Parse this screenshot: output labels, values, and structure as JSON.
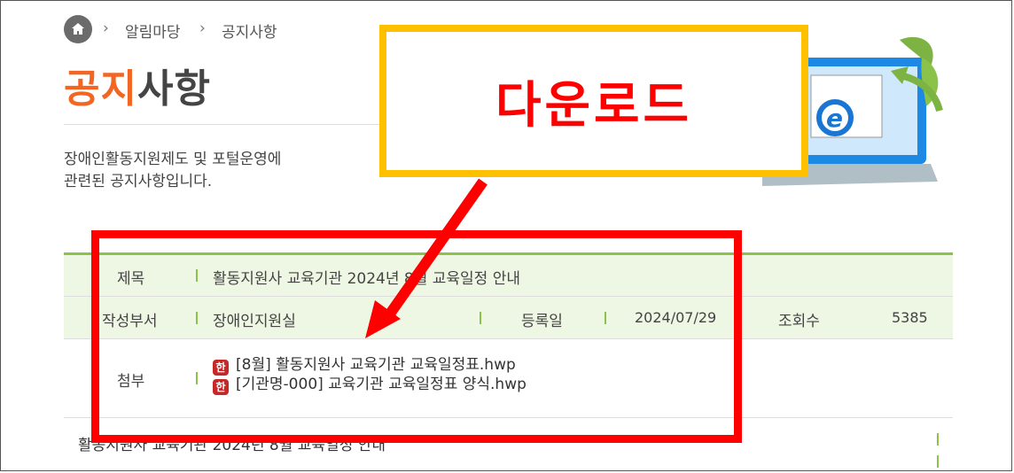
{
  "breadcrumb": {
    "items": [
      "알림마당",
      "공지사항"
    ]
  },
  "page": {
    "title_highlight": "공지",
    "title_rest": "사항",
    "description_line1": "장애인활동지원제도 및 포털운영에",
    "description_line2": "관련된 공지사항입니다."
  },
  "notice": {
    "subject_label": "제목",
    "subject_value": "활동지원사 교육기관 2024년 8월 교육일정 안내",
    "dept_label": "작성부서",
    "dept_value": "장애인지원실",
    "date_label": "등록일",
    "date_value": "2024/07/29",
    "views_label": "조회수",
    "views_value": "5385",
    "attach_label": "첨부",
    "attachments": [
      {
        "name": "[8월] 활동지원사 교육기관 교육일정표.hwp",
        "icon": "hwp-file-icon"
      },
      {
        "name": "[기관명-000] 교육기관 교육일정표 양식.hwp",
        "icon": "hwp-file-icon"
      }
    ],
    "body_text": "활동지원사 교육기관 2024년 8월 교육일정 안내"
  },
  "annotation": {
    "callout_text": "다운로드",
    "callout_border": "#ffc000",
    "callout_text_color": "#ff0000",
    "box_color": "#ff0000"
  },
  "colors": {
    "accent_orange": "#f26522",
    "accent_green": "#8bc34a",
    "row_bg": "#eef6e4"
  },
  "hwp_icon_glyph": "한"
}
